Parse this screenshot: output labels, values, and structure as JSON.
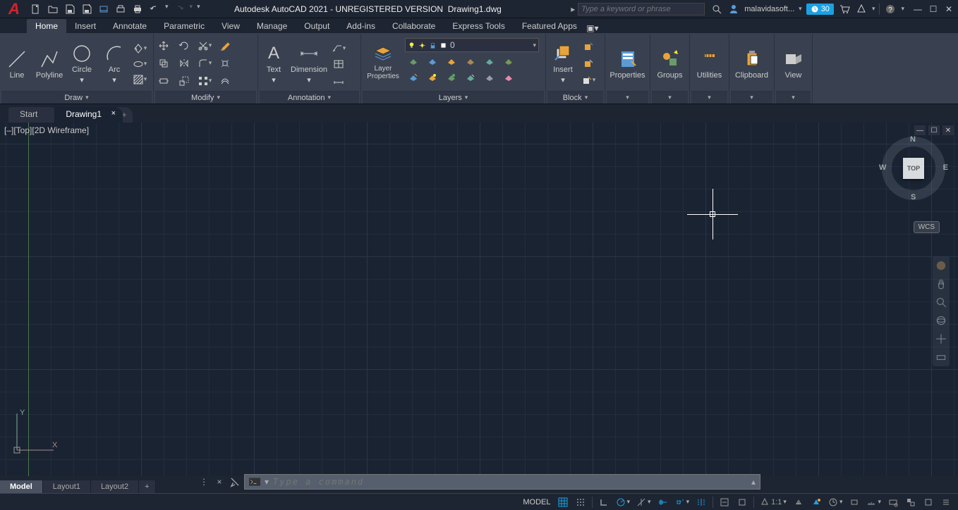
{
  "titlebar": {
    "app_title": "Autodesk AutoCAD 2021 - UNREGISTERED VERSION",
    "filename": "Drawing1.dwg",
    "search_placeholder": "Type a keyword or phrase",
    "username": "malavidasoft...",
    "trial_days": "30"
  },
  "menu": {
    "tabs": [
      "Home",
      "Insert",
      "Annotate",
      "Parametric",
      "View",
      "Manage",
      "Output",
      "Add-ins",
      "Collaborate",
      "Express Tools",
      "Featured Apps"
    ],
    "active": 0
  },
  "ribbon": {
    "draw": {
      "label": "Draw",
      "tools": {
        "line": "Line",
        "polyline": "Polyline",
        "circle": "Circle",
        "arc": "Arc"
      }
    },
    "modify": {
      "label": "Modify"
    },
    "annotation": {
      "label": "Annotation",
      "text": "Text",
      "dimension": "Dimension"
    },
    "layers": {
      "label": "Layers",
      "properties": "Layer\nProperties",
      "current_layer": "0"
    },
    "block": {
      "label": "Block",
      "insert": "Insert"
    },
    "properties": {
      "label": "Properties"
    },
    "groups": {
      "label": "Groups"
    },
    "utilities": {
      "label": "Utilities"
    },
    "clipboard": {
      "label": "Clipboard"
    },
    "view": {
      "label": "View"
    }
  },
  "filetabs": {
    "tabs": [
      "Start",
      "Drawing1"
    ],
    "active": 1
  },
  "viewport": {
    "label_parts": [
      "[–]",
      "[Top]",
      "[2D Wireframe]"
    ],
    "viewcube": {
      "face": "TOP",
      "n": "N",
      "s": "S",
      "e": "E",
      "w": "W"
    },
    "wcs": "WCS"
  },
  "ucs": {
    "y": "Y",
    "x": "X"
  },
  "cmdline": {
    "placeholder": "Type a command"
  },
  "layout_tabs": {
    "tabs": [
      "Model",
      "Layout1",
      "Layout2"
    ],
    "active": 0
  },
  "statusbar": {
    "model": "MODEL",
    "scale": "1:1"
  }
}
